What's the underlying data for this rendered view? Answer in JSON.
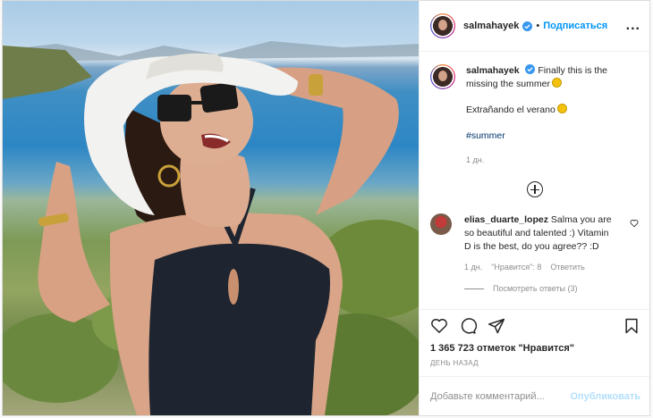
{
  "post": {
    "username": "salmahayek",
    "follow_label": "Подписаться",
    "more_label": "...",
    "caption": {
      "text": "Finally this is the missing the summer",
      "line2": "Extrañando el verano",
      "hashtag": "#summer",
      "time": "1 дн."
    },
    "comments": [
      {
        "username": "elias_duarte_lopez",
        "text": "Salma you are so beautiful and talented :) Vitamin D is the best, do you agree?? :D",
        "time": "1 дн.",
        "likes": "\"Нравится\": 8",
        "reply_label": "Ответить",
        "view_replies": "Посмотреть ответы (3)"
      }
    ],
    "likes_count": "1 365 723 отметок \"Нравится\"",
    "date": "ДЕНЬ НАЗАД",
    "add_comment_placeholder": "Добавьте комментарий...",
    "publish_label": "Опубликовать"
  },
  "icons": {
    "verified": "verified-badge-icon",
    "like": "heart-icon",
    "comment": "comment-icon",
    "share": "paper-plane-icon",
    "save": "bookmark-icon",
    "load_more": "plus-circle-icon",
    "emoji": "sun-emoji"
  },
  "colors": {
    "link": "#0095f6",
    "hashtag": "#00376b",
    "muted": "#8e8e8e",
    "publish_disabled": "#b2dffc"
  }
}
